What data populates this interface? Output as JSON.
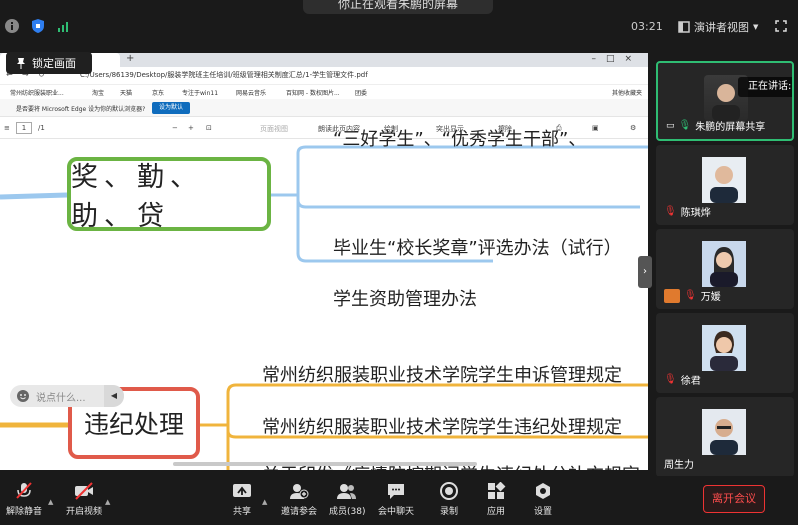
{
  "topbar": {
    "share_banner": "你正在观看朱鹏的屏幕",
    "time": "03:21",
    "view_mode": "演讲者视图"
  },
  "lock_button": "锁定画面",
  "browser": {
    "address": "C:/Users/86139/Desktop/服装学院班主任培训/班级管理相关制度汇总/1-学生管理文件.pdf",
    "bookmarks": [
      "常州纺织服装职业...",
      "淘宝",
      "天猫",
      "京东",
      "专注于win11",
      "网易云音乐",
      "百知网 - 数权图片...",
      "团委",
      "其他收藏夹"
    ],
    "edge_prompt": "是否要将 Microsoft Edge 设为你的默认浏览器?",
    "edge_set_default": "设为默认",
    "pdf_page": "1",
    "pdf_total": "/1",
    "pdf_tools": [
      "页面视图",
      "朗读此页内容",
      "绘制",
      "突出显示",
      "擦除"
    ]
  },
  "mindmap": {
    "group1": {
      "title": "奖、勤、助、贷",
      "items": [
        "“三好学生”、“优秀学生干部”、",
        "毕业生“校长奖章”评选办法（试行）",
        "学生资助管理办法"
      ]
    },
    "group2": {
      "title": "违纪处理",
      "items": [
        "常州纺织服装职业技术学院学生申诉管理规定",
        "常州纺织服装职业技术学院学生违纪处理规定",
        "关于印发《疫情防控期间学生违纪处分补充规定"
      ]
    },
    "colors": {
      "green": "#6bb443",
      "red": "#e05a4a",
      "blue": "#9cc8ee",
      "orange": "#f0b43c"
    }
  },
  "chat_placeholder": "说点什么...",
  "participants": [
    {
      "name": "朱鹏的屏幕共享",
      "speaking": "正在讲话: 朱"
    },
    {
      "name": "陈琪烨"
    },
    {
      "name": "万媛"
    },
    {
      "name": "徐君"
    },
    {
      "name": "周生力"
    }
  ],
  "toolbar": {
    "mute": "解除静音",
    "video": "开启视频",
    "share": "共享",
    "invite": "邀请参会",
    "members": "成员(38)",
    "chat": "会中聊天",
    "record": "录制",
    "apps": "应用",
    "settings": "设置",
    "leave": "离开会议"
  }
}
